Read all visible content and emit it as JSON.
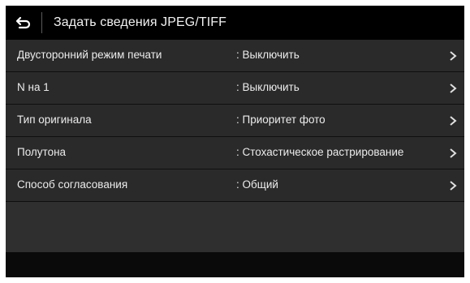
{
  "header": {
    "back_icon": "back-arrow-icon",
    "title": "Задать сведения JPEG/TIFF"
  },
  "settings": [
    {
      "label": "Двусторонний режим печати",
      "value": ": Выключить"
    },
    {
      "label": "N на 1",
      "value": ": Выключить"
    },
    {
      "label": "Тип оригинала",
      "value": ": Приоритет фото"
    },
    {
      "label": "Полутона",
      "value": ": Стохастическое растрирование"
    },
    {
      "label": "Способ согласования",
      "value": ": Общий"
    }
  ],
  "colors": {
    "title_bg": "#000000",
    "row_bg": "#2a2a2a",
    "text": "#ececec"
  }
}
